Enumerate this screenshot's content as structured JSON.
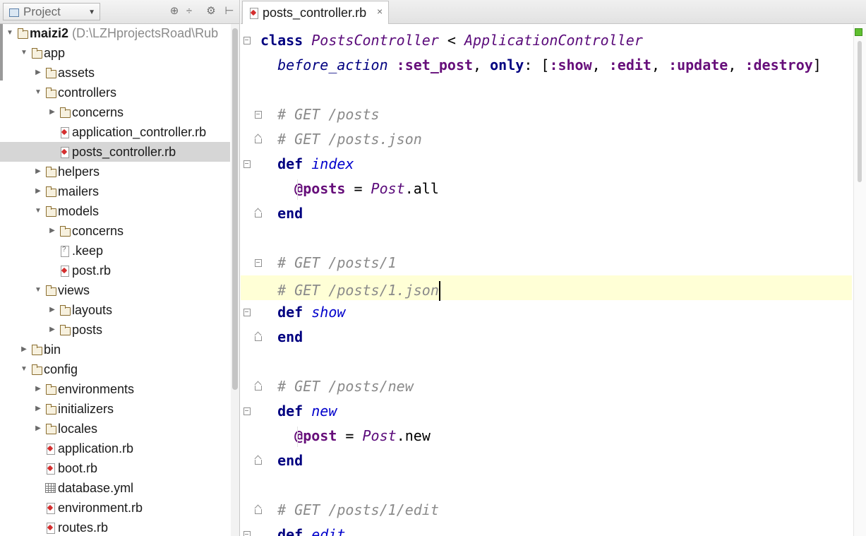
{
  "project_panel": {
    "view_label": "Project",
    "tree": [
      {
        "label": "maizi2",
        "path": " (D:\\LZHprojectsRoad\\Rub",
        "type": "folder",
        "depth": 0,
        "expanded": true,
        "bold": true
      },
      {
        "label": "app",
        "type": "folder",
        "depth": 1,
        "expanded": true
      },
      {
        "label": "assets",
        "type": "folder",
        "depth": 2,
        "expanded": false
      },
      {
        "label": "controllers",
        "type": "folder",
        "depth": 2,
        "expanded": true
      },
      {
        "label": "concerns",
        "type": "folder",
        "depth": 3,
        "expanded": false
      },
      {
        "label": "application_controller.rb",
        "type": "rb",
        "depth": 3
      },
      {
        "label": "posts_controller.rb",
        "type": "rb",
        "depth": 3,
        "selected": true
      },
      {
        "label": "helpers",
        "type": "folder",
        "depth": 2,
        "expanded": false
      },
      {
        "label": "mailers",
        "type": "folder",
        "depth": 2,
        "expanded": false
      },
      {
        "label": "models",
        "type": "folder",
        "depth": 2,
        "expanded": true
      },
      {
        "label": "concerns",
        "type": "folder",
        "depth": 3,
        "expanded": false
      },
      {
        "label": ".keep",
        "type": "txt",
        "depth": 3
      },
      {
        "label": "post.rb",
        "type": "rb",
        "depth": 3
      },
      {
        "label": "views",
        "type": "folder",
        "depth": 2,
        "expanded": true
      },
      {
        "label": "layouts",
        "type": "folder",
        "depth": 3,
        "expanded": false
      },
      {
        "label": "posts",
        "type": "folder",
        "depth": 3,
        "expanded": false
      },
      {
        "label": "bin",
        "type": "folder",
        "depth": 1,
        "expanded": false
      },
      {
        "label": "config",
        "type": "folder",
        "depth": 1,
        "expanded": true
      },
      {
        "label": "environments",
        "type": "folder",
        "depth": 2,
        "expanded": false
      },
      {
        "label": "initializers",
        "type": "folder",
        "depth": 2,
        "expanded": false
      },
      {
        "label": "locales",
        "type": "folder",
        "depth": 2,
        "expanded": false
      },
      {
        "label": "application.rb",
        "type": "rb",
        "depth": 2
      },
      {
        "label": "boot.rb",
        "type": "rb",
        "depth": 2
      },
      {
        "label": "database.yml",
        "type": "yml",
        "depth": 2
      },
      {
        "label": "environment.rb",
        "type": "rb",
        "depth": 2
      },
      {
        "label": "routes.rb",
        "type": "rb",
        "depth": 2
      }
    ]
  },
  "editor": {
    "tab_label": "posts_controller.rb",
    "tab_close": "×",
    "lines": [
      {
        "parts": [
          [
            "kw",
            "class "
          ],
          [
            "cls",
            "PostsController"
          ],
          [
            "plain",
            " < "
          ],
          [
            "cls",
            "ApplicationController"
          ]
        ],
        "gutter": "fold-open"
      },
      {
        "parts": [
          [
            "plain",
            "  "
          ],
          [
            "call",
            "before_action "
          ],
          [
            "sym",
            ":set_post"
          ],
          [
            "plain",
            ", "
          ],
          [
            "kw",
            "only"
          ],
          [
            "plain",
            ": ["
          ],
          [
            "sym",
            ":show"
          ],
          [
            "plain",
            ", "
          ],
          [
            "sym",
            ":edit"
          ],
          [
            "plain",
            ", "
          ],
          [
            "sym",
            ":update"
          ],
          [
            "plain",
            ", "
          ],
          [
            "sym",
            ":destroy"
          ],
          [
            "plain",
            "]"
          ]
        ]
      },
      {
        "parts": []
      },
      {
        "parts": [
          [
            "plain",
            "  "
          ],
          [
            "cmt",
            "# GET /posts"
          ]
        ],
        "gutter": "fold-open"
      },
      {
        "parts": [
          [
            "plain",
            "  "
          ],
          [
            "cmt",
            "# GET /posts.json"
          ]
        ],
        "gutter": "fold-end"
      },
      {
        "parts": [
          [
            "plain",
            "  "
          ],
          [
            "kw",
            "def "
          ],
          [
            "meth",
            "index"
          ]
        ],
        "gutter": "fold-start-def"
      },
      {
        "parts": [
          [
            "plain",
            "    "
          ],
          [
            "ivar",
            "@posts"
          ],
          [
            "plain",
            " = "
          ],
          [
            "cls",
            "Post"
          ],
          [
            "plain",
            "."
          ],
          [
            "plain",
            "all"
          ]
        ]
      },
      {
        "parts": [
          [
            "plain",
            "  "
          ],
          [
            "kw",
            "end"
          ]
        ],
        "gutter": "fold-end"
      },
      {
        "parts": []
      },
      {
        "parts": [
          [
            "plain",
            "  "
          ],
          [
            "cmt",
            "# GET /posts/1"
          ]
        ],
        "gutter": "fold-open"
      },
      {
        "parts": [
          [
            "plain",
            "  "
          ],
          [
            "cmt",
            "# GET /posts/1.json"
          ]
        ],
        "gutter": "fold-end",
        "current": true
      },
      {
        "parts": [
          [
            "plain",
            "  "
          ],
          [
            "kw",
            "def "
          ],
          [
            "meth",
            "show"
          ]
        ],
        "gutter": "fold-start-def"
      },
      {
        "parts": [
          [
            "plain",
            "  "
          ],
          [
            "kw",
            "end"
          ]
        ],
        "gutter": "fold-end"
      },
      {
        "parts": []
      },
      {
        "parts": [
          [
            "plain",
            "  "
          ],
          [
            "cmt",
            "# GET /posts/new"
          ]
        ],
        "gutter": "fold-end"
      },
      {
        "parts": [
          [
            "plain",
            "  "
          ],
          [
            "kw",
            "def "
          ],
          [
            "meth",
            "new"
          ]
        ],
        "gutter": "fold-start-def"
      },
      {
        "parts": [
          [
            "plain",
            "    "
          ],
          [
            "ivar",
            "@post"
          ],
          [
            "plain",
            " = "
          ],
          [
            "cls",
            "Post"
          ],
          [
            "plain",
            "."
          ],
          [
            "plain",
            "new"
          ]
        ]
      },
      {
        "parts": [
          [
            "plain",
            "  "
          ],
          [
            "kw",
            "end"
          ]
        ],
        "gutter": "fold-end"
      },
      {
        "parts": []
      },
      {
        "parts": [
          [
            "plain",
            "  "
          ],
          [
            "cmt",
            "# GET /posts/1/edit"
          ]
        ],
        "gutter": "fold-end"
      },
      {
        "parts": [
          [
            "plain",
            "  "
          ],
          [
            "kw",
            "def "
          ],
          [
            "meth",
            "edit"
          ]
        ],
        "gutter": "fold-start-def"
      }
    ]
  },
  "colors": {
    "selection": "#d6d6d6",
    "current_line": "#ffffd6",
    "keyword": "#000080",
    "symbol": "#660e7a",
    "comment": "#8a8a8a",
    "ok_status": "#5fbf2f"
  }
}
